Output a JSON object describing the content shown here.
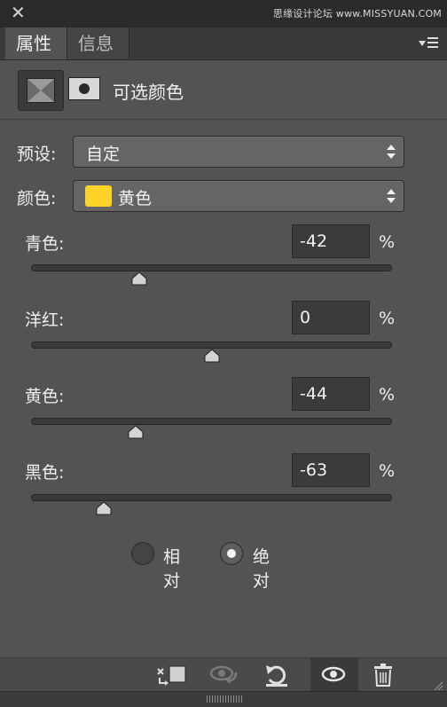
{
  "window": {
    "close_glyph": "✕",
    "watermark": "思缘设计论坛 www.MISSYUAN.COM"
  },
  "tabs": [
    {
      "label": "属性",
      "active": true
    },
    {
      "label": "信息",
      "active": false
    }
  ],
  "adjustment": {
    "title": "可选颜色",
    "icons": [
      "adjustment-layer-icon",
      "mask-icon"
    ]
  },
  "preset": {
    "label": "预设:",
    "value": "自定"
  },
  "colors": {
    "label": "颜色:",
    "value": "黄色",
    "swatch_color": "#ffd42a"
  },
  "sliders": [
    {
      "label": "青色:",
      "value": "-42",
      "unit": "%",
      "level": -42
    },
    {
      "label": "洋红:",
      "value": "0",
      "unit": "%",
      "level": 0
    },
    {
      "label": "黄色:",
      "value": "-44",
      "unit": "%",
      "level": -44
    },
    {
      "label": "黑色:",
      "value": "-63",
      "unit": "%",
      "level": -63
    }
  ],
  "method": {
    "options": [
      {
        "label": "相对",
        "checked": false
      },
      {
        "label": "绝对",
        "checked": true
      }
    ]
  },
  "bottom_toolbar": {
    "icons": [
      "clip-to-layer-icon",
      "view-previous-state-icon",
      "reset-icon",
      "visibility-eye-icon",
      "trash-icon"
    ]
  }
}
